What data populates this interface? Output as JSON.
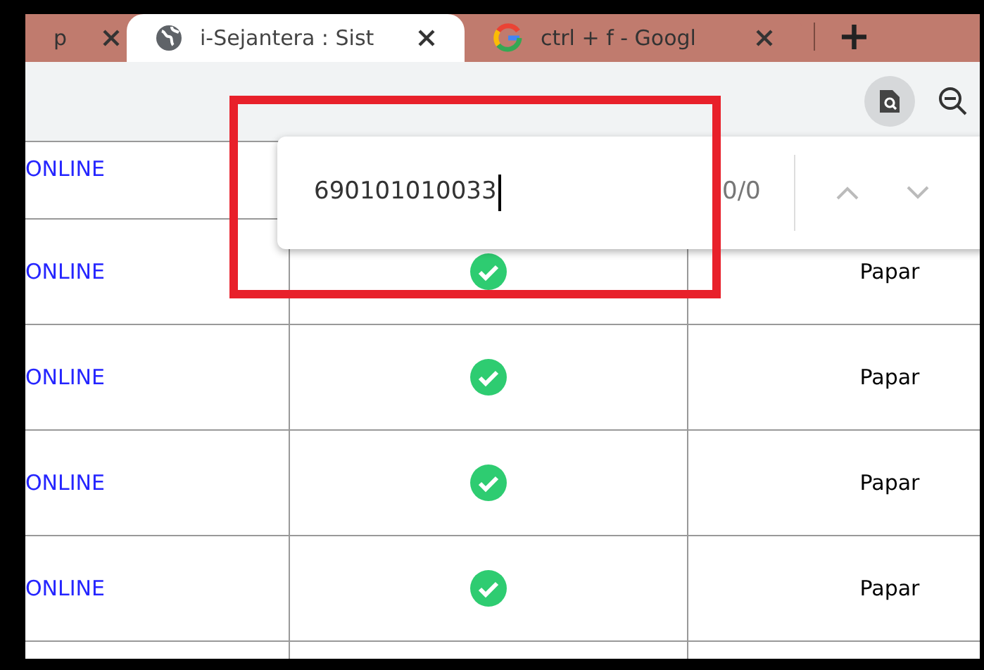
{
  "tabs": [
    {
      "title": "p",
      "selected": false,
      "kind": "plain"
    },
    {
      "title": "i-Sejantera : Sist",
      "selected": true,
      "kind": "globe"
    },
    {
      "title": "ctrl + f - Googl",
      "selected": false,
      "kind": "google"
    }
  ],
  "new_tab": "+",
  "find_bar": {
    "query": "690101010033",
    "count": "0/0"
  },
  "table": {
    "rows": [
      {
        "status": "ONLINE",
        "kind": "covered"
      },
      {
        "status": "ONLINE",
        "kind": "full",
        "verified": true,
        "column_3": "Papar"
      },
      {
        "status": "ONLINE",
        "kind": "full",
        "verified": true,
        "column_3": "Papar"
      },
      {
        "status": "ONLINE",
        "kind": "full",
        "verified": true,
        "column_3": "Papar"
      },
      {
        "status": "ONLINE",
        "kind": "full",
        "verified": true,
        "column_3": "Papar"
      }
    ]
  }
}
